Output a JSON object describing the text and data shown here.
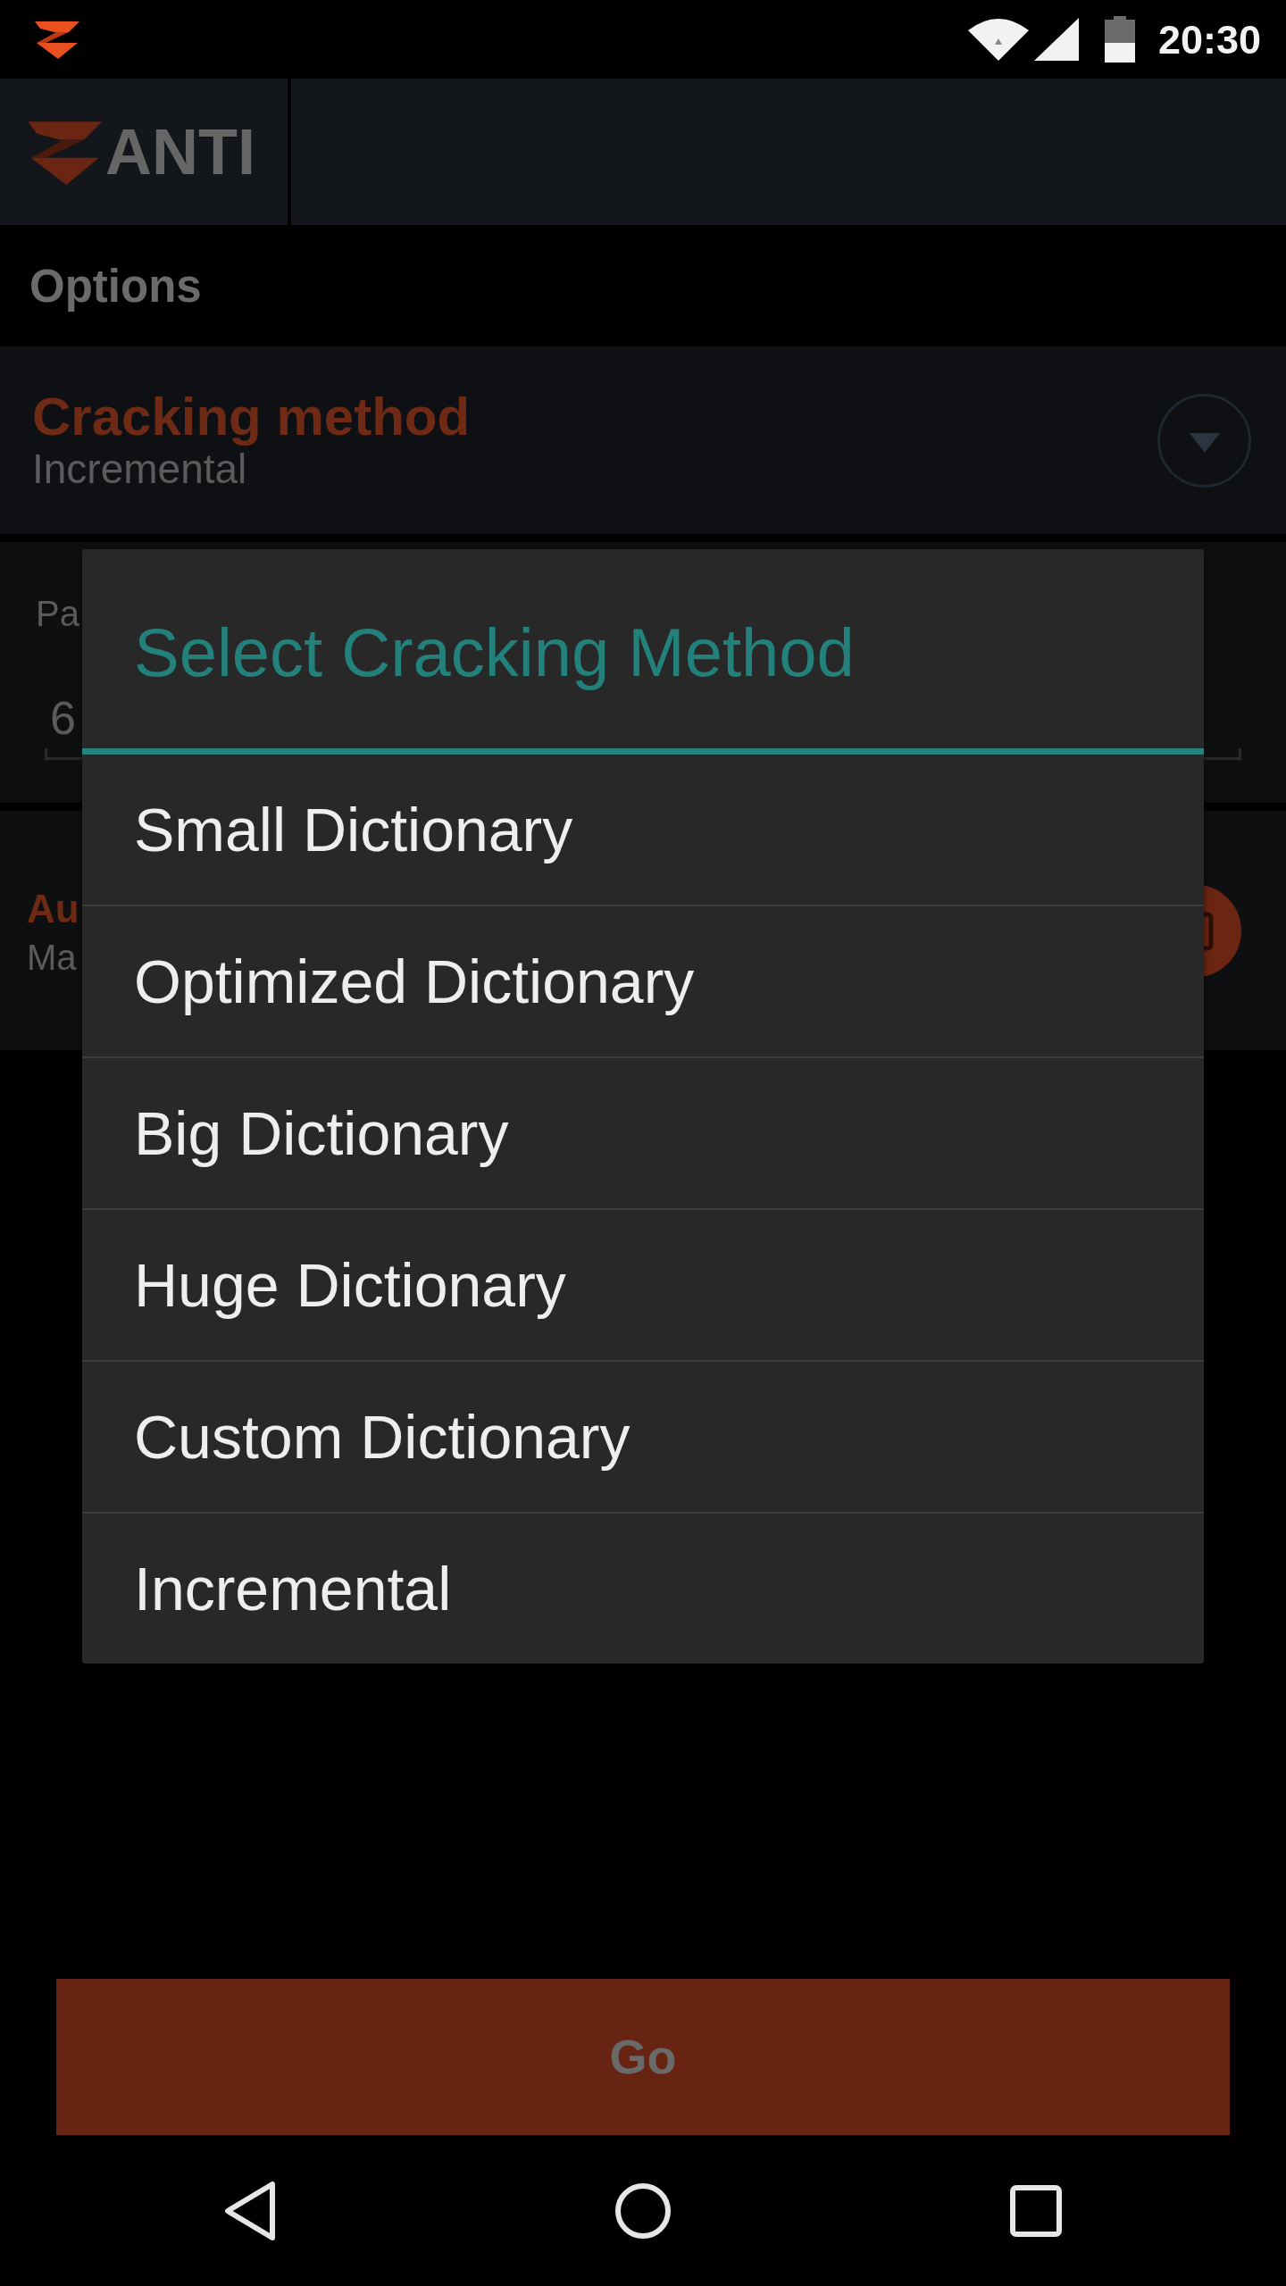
{
  "status_bar": {
    "time": "20:30"
  },
  "app_bar": {
    "logo_text": "ANTI"
  },
  "section_title": "Options",
  "options": [
    {
      "kind": "dropdown",
      "title": "Cracking method",
      "value": "Incremental"
    },
    {
      "kind": "field",
      "label": "Pa",
      "value": "6"
    },
    {
      "kind": "toggle",
      "title": "Au",
      "subtitle": "Ma"
    }
  ],
  "dialog": {
    "title": "Select Cracking Method",
    "items": [
      "Small Dictionary",
      "Optimized Dictionary",
      "Big Dictionary",
      "Huge Dictionary",
      "Custom Dictionary",
      "Incremental"
    ]
  },
  "go_button": {
    "label": "Go"
  }
}
